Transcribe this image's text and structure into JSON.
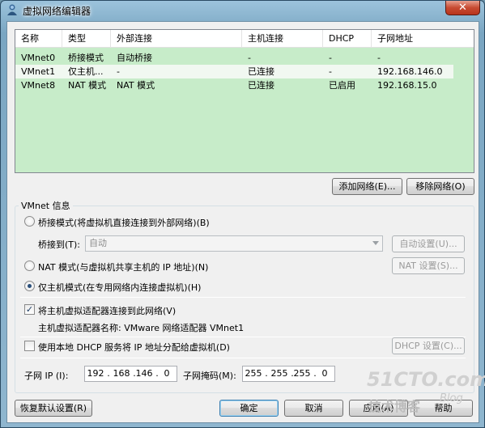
{
  "window": {
    "title": "虚拟网络编辑器",
    "close_label": "✕"
  },
  "table": {
    "columns": [
      "名称",
      "类型",
      "外部连接",
      "主机连接",
      "DHCP",
      "子网地址"
    ],
    "rows": [
      {
        "name": "VMnet0",
        "type": "桥接模式",
        "external": "自动桥接",
        "host": "-",
        "dhcp": "-",
        "subnet": "-"
      },
      {
        "name": "VMnet1",
        "type": "仅主机...",
        "external": "-",
        "host": "已连接",
        "dhcp": "-",
        "subnet": "192.168.146.0"
      },
      {
        "name": "VMnet8",
        "type": "NAT 模式",
        "external": "NAT 模式",
        "host": "已连接",
        "dhcp": "已启用",
        "subnet": "192.168.15.0"
      }
    ],
    "selected_row": "VMnet1"
  },
  "buttons": {
    "add_network": "添加网络(E)...",
    "remove_network": "移除网络(O)",
    "auto_settings": "自动设置(U)...",
    "nat_settings": "NAT 设置(S)...",
    "dhcp_settings": "DHCP 设置(C)...",
    "restore_defaults": "恢复默认设置(R)",
    "ok": "确定",
    "cancel": "取消",
    "apply": "应用(A)",
    "help": "帮助"
  },
  "vmnet_info": {
    "legend": "VMnet 信息",
    "bridged_label": "桥接模式(将虚拟机直接连接到外部网络)(B)",
    "bridge_to_label": "桥接到(T):",
    "bridge_to_value": "自动",
    "nat_label": "NAT 模式(与虚拟机共享主机的 IP 地址)(N)",
    "hostonly_label": "仅主机模式(在专用网络内连接虚拟机)(H)",
    "selected_mode": "hostonly",
    "connect_adapter_label": "将主机虚拟适配器连接到此网络(V)",
    "connect_adapter_checked": true,
    "adapter_name_label": "主机虚拟适配器名称: VMware 网络适配器 VMnet1",
    "use_dhcp_label": "使用本地 DHCP 服务将 IP 地址分配给虚拟机(D)",
    "use_dhcp_checked": false,
    "subnet_ip_label": "子网 IP (I):",
    "subnet_ip": [
      "192",
      "168",
      "146",
      "0"
    ],
    "subnet_mask_label": "子网掩码(M):",
    "subnet_mask": [
      "255",
      "255",
      "255",
      "0"
    ]
  },
  "watermark": {
    "logo": "51CTO.com",
    "sub": "技术博客",
    "blog": "Blog"
  },
  "colors": {
    "list_background": "#c7ecc9",
    "selected_row": "#f1f8f1",
    "titlebar": "#8fb6cf",
    "close_button": "#c74b32"
  }
}
